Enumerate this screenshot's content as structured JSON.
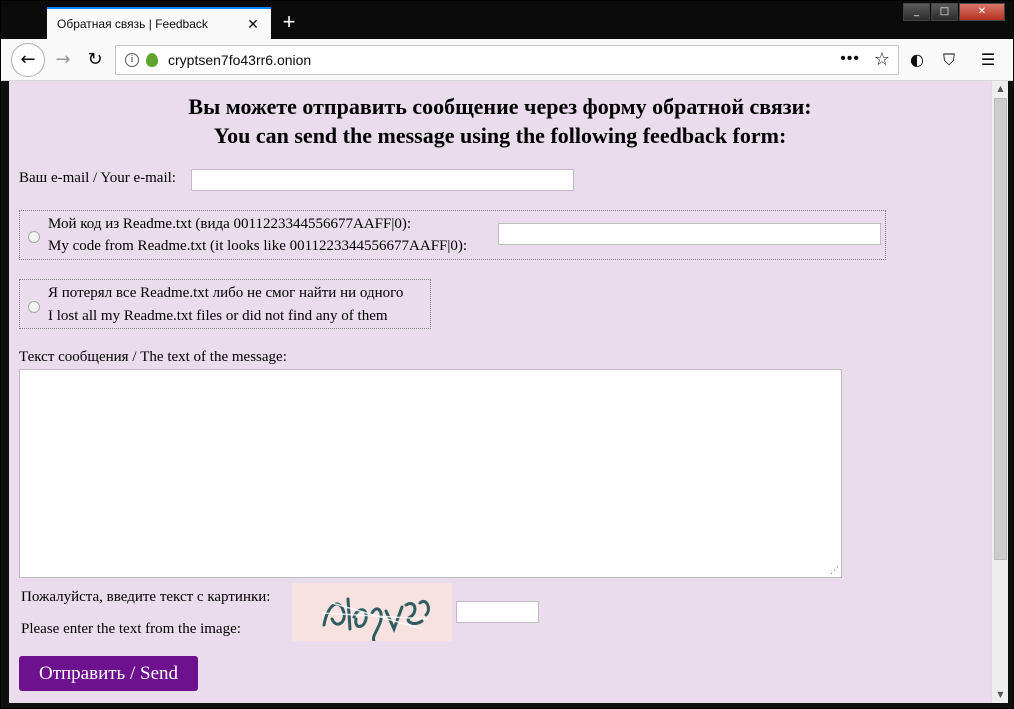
{
  "browser": {
    "tab_title": "Обратная связь | Feedback",
    "tab_close": "✕",
    "new_tab": "+",
    "url": "cryptsen7fo43rr6.onion",
    "url_more": "•••",
    "window_buttons": [
      "_",
      "□",
      "✕"
    ]
  },
  "page": {
    "heading_ru": "Вы можете отправить сообщение через форму обратной связи:",
    "heading_en": "You can send the message using the following feedback form:",
    "email_label": "Ваш e-mail / Your e-mail:",
    "option_code_ru": "Мой код из Readme.txt (вида 0011223344556677AAFF|0):",
    "option_code_en": "My code from Readme.txt (it looks like 0011223344556677AAFF|0):",
    "option_lost_ru": "Я потерял все Readme.txt либо не смог найти ни одного",
    "option_lost_en": "I lost all my Readme.txt files or did not find any of them",
    "message_label": "Текст сообщения / The text of the message:",
    "captcha_label_ru": "Пожалуйста, введите текст с картинки:",
    "captcha_label_en": "Please enter the text from the image:",
    "send_button": "Отправить / Send"
  },
  "colors": {
    "page_background": "#eadcec",
    "send_button": "#6e118f",
    "captcha_background": "#f7e1e1",
    "tab_accent": "#0a84ff"
  },
  "icons": [
    "back-icon",
    "forward-icon",
    "reload-icon",
    "info-icon",
    "onion-icon",
    "star-icon",
    "tor-icon",
    "shield-icon",
    "menu-icon"
  ]
}
